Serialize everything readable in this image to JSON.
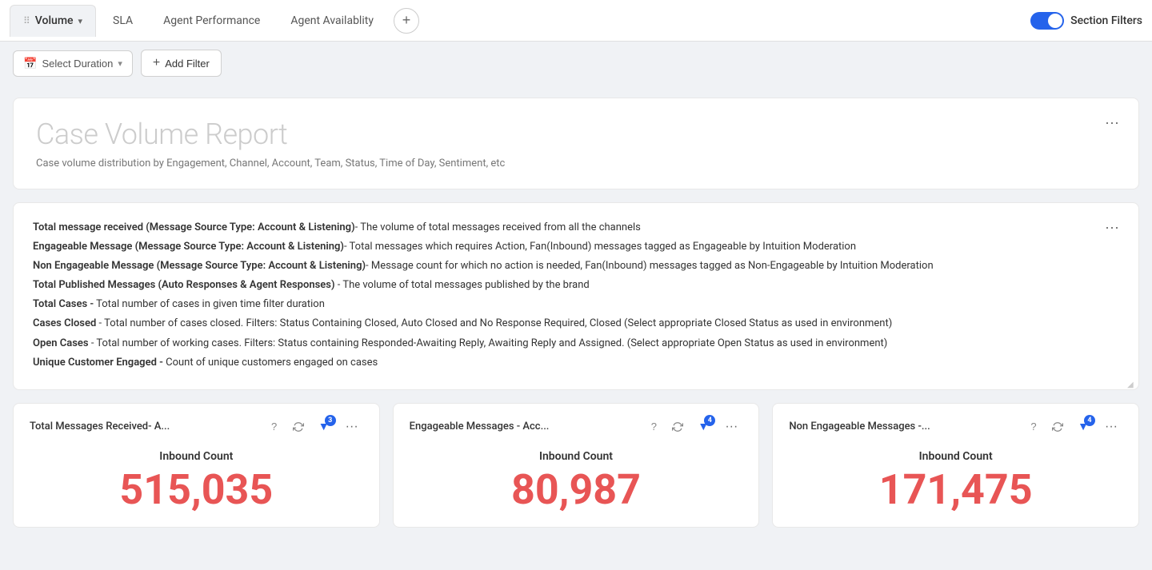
{
  "tabs": [
    {
      "id": "volume",
      "label": "Volume",
      "active": true,
      "hasDrag": true,
      "hasChevron": true
    },
    {
      "id": "sla",
      "label": "SLA",
      "active": false
    },
    {
      "id": "agent-performance",
      "label": "Agent Performance",
      "active": false
    },
    {
      "id": "agent-availability",
      "label": "Agent Availablity",
      "active": false
    }
  ],
  "tab_add_label": "+",
  "section_filters": {
    "label": "Section Filters",
    "enabled": true
  },
  "filter_bar": {
    "select_duration_label": "Select Duration",
    "add_filter_label": "Add Filter"
  },
  "report_card": {
    "title": "Case Volume Report",
    "subtitle": "Case volume distribution by Engagement, Channel, Account, Team, Status, Time of Day, Sentiment, etc"
  },
  "info_card": {
    "items": [
      {
        "bold": "Total message received (Message Source Type: Account & Listening)",
        "text": "- The volume of total messages received from all the channels"
      },
      {
        "bold": "Engageable Message (Message Source Type: Account & Listening)",
        "text": "- Total messages which requires Action, Fan(Inbound) messages tagged as Engageable by Intuition Moderation"
      },
      {
        "bold": "Non Engageable Message (Message Source Type: Account & Listening)",
        "text": "- Message count for which no action is needed, Fan(Inbound) messages tagged as Non-Engageable by Intuition Moderation"
      },
      {
        "bold": "Total Published Messages (Auto Responses & Agent Responses)",
        "text": " - The volume of total messages published by the brand"
      },
      {
        "bold": "Total Cases -",
        "text": " Total number of cases in given time filter duration"
      },
      {
        "bold": "Cases Closed",
        "text": " - Total number of cases closed. Filters: Status Containing Closed, Auto Closed and No Response Required, Closed (Select appropriate Closed Status as used in environment)"
      },
      {
        "bold": "Open Cases",
        "text": " - Total number of working cases. Filters: Status containing Responded-Awaiting Reply, Awaiting Reply and Assigned. (Select appropriate Open Status as used in environment)"
      },
      {
        "bold": "Unique Customer Engaged -",
        "text": " Count of unique customers engaged on cases"
      }
    ]
  },
  "metric_cards": [
    {
      "id": "total-messages",
      "title": "Total Messages Received- A...",
      "badge": "3",
      "inbound_label": "Inbound Count",
      "value": "515,035"
    },
    {
      "id": "engageable-messages",
      "title": "Engageable Messages - Acc...",
      "badge": "4",
      "inbound_label": "Inbound Count",
      "value": "80,987"
    },
    {
      "id": "non-engageable-messages",
      "title": "Non Engageable Messages -...",
      "badge": "4",
      "inbound_label": "Inbound Count",
      "value": "171,475"
    }
  ]
}
